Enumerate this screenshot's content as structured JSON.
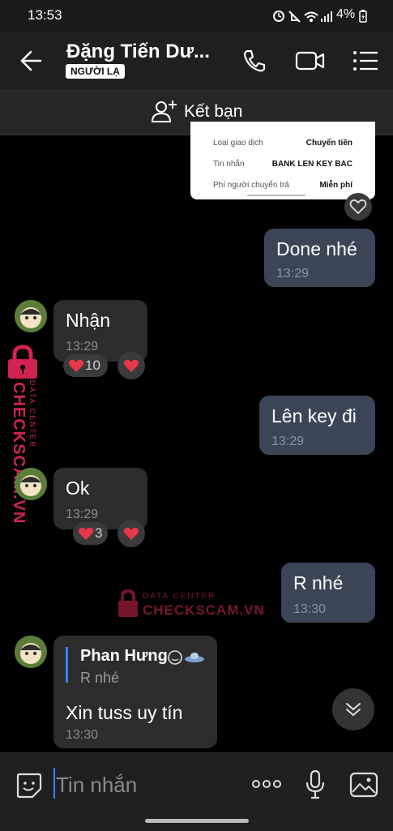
{
  "status_bar": {
    "time": "13:53",
    "battery": "4%"
  },
  "header": {
    "contact_name": "Đặng Tiến Dư...",
    "badge": "NGƯỜI LẠ"
  },
  "friend_bar": {
    "label": "Kết bạn"
  },
  "image_preview": {
    "rows": [
      {
        "label": "Loại giao dịch",
        "value": "Chuyển tiền"
      },
      {
        "label": "Tin nhắn",
        "value": "BANK LEN KEY BAC"
      },
      {
        "label": "Phí người chuyển trả",
        "value": "Miễn phí"
      }
    ]
  },
  "messages": [
    {
      "direction": "out",
      "text": "Done nhé",
      "time": "13:29"
    },
    {
      "direction": "in",
      "text": "Nhận",
      "time": "13:29",
      "reaction": "10"
    },
    {
      "direction": "out",
      "text": "Lên key đi",
      "time": "13:29"
    },
    {
      "direction": "in",
      "text": "Ok",
      "time": "13:29",
      "reaction": "3"
    },
    {
      "direction": "out",
      "text": "R nhé",
      "time": "13:30"
    },
    {
      "direction": "in",
      "quote_author": "Phan Hưng",
      "quote_text": "R nhé",
      "text": "Xin tuss uy tín",
      "time": "13:30"
    }
  ],
  "watermark": {
    "top": "DATA CENTER",
    "brand": "CHECKSCAM.VN"
  },
  "composer": {
    "placeholder": "Tin nhắn"
  },
  "colors": {
    "outgoing_bubble": "#3a4656",
    "incoming_bubble": "#2c2c2c",
    "heart": "#e8354a",
    "watermark": "#d0234f"
  }
}
